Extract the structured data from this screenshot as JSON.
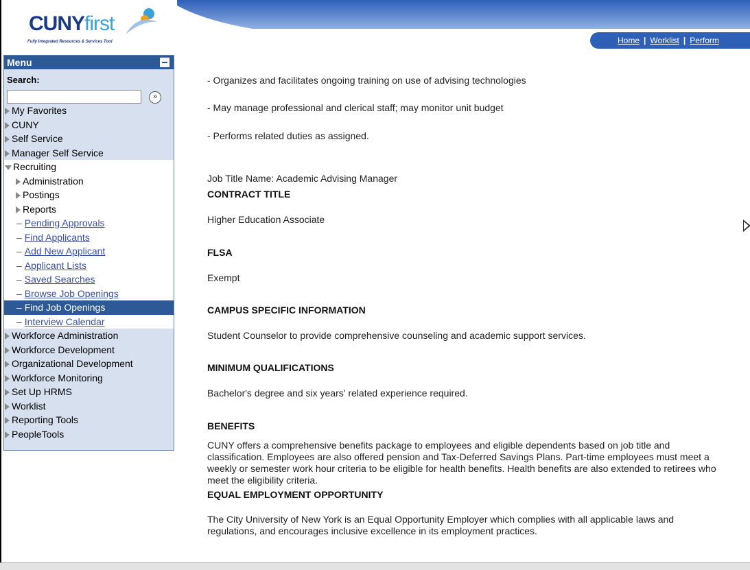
{
  "logo": {
    "brand_bold": "CUNY",
    "brand_thin": "first",
    "tagline": "Fully Integrated Resources & Services Tool"
  },
  "topnav": {
    "home": "Home",
    "worklist": "Worklist",
    "perform": "Perform"
  },
  "menu": {
    "title": "Menu",
    "search_label": "Search:",
    "search_value": "",
    "search_go": "»",
    "items": [
      {
        "label": "My Favorites"
      },
      {
        "label": "CUNY"
      },
      {
        "label": "Self Service"
      },
      {
        "label": "Manager Self Service"
      }
    ],
    "recruiting": {
      "label": "Recruiting",
      "folders": [
        {
          "label": "Administration"
        },
        {
          "label": "Postings"
        },
        {
          "label": "Reports"
        }
      ],
      "links": [
        {
          "label": "Pending Approvals"
        },
        {
          "label": "Find Applicants"
        },
        {
          "label": "Add New Applicant"
        },
        {
          "label": "Applicant Lists"
        },
        {
          "label": "Saved Searches"
        },
        {
          "label": "Browse Job Openings"
        },
        {
          "label": "Find Job Openings"
        },
        {
          "label": "Interview Calendar"
        }
      ]
    },
    "items_after": [
      {
        "label": "Workforce Administration"
      },
      {
        "label": "Workforce Development"
      },
      {
        "label": "Organizational Development"
      },
      {
        "label": "Workforce Monitoring"
      },
      {
        "label": "Set Up HRMS"
      },
      {
        "label": "Worklist"
      },
      {
        "label": "Reporting Tools"
      },
      {
        "label": "PeopleTools"
      }
    ]
  },
  "content": {
    "bullets": [
      "- Organizes and facilitates ongoing training on use of advising technologies",
      "- May manage professional and clerical staff; may monitor unit budget",
      "- Performs related duties as assigned."
    ],
    "job_title_name": "Job Title Name:  Academic Advising Manager",
    "sections": [
      {
        "heading": "CONTRACT TITLE",
        "text": "Higher Education Associate"
      },
      {
        "heading": "FLSA",
        "text": "Exempt"
      },
      {
        "heading": "CAMPUS SPECIFIC INFORMATION",
        "text": "Student Counselor to provide comprehensive counseling and academic support services."
      },
      {
        "heading": "MINIMUM QUALIFICATIONS",
        "text": "Bachelor's degree and six years' related experience required."
      },
      {
        "heading": "BENEFITS",
        "text": "CUNY offers a comprehensive benefits package to employees and eligible dependents based on job title and classification. Employees are also offered pension and Tax-Deferred Savings Plans.  Part-time employees must meet a weekly or semester work hour criteria to be eligible for health benefits. Health benefits are also extended to retirees who meet the eligibility criteria."
      },
      {
        "heading": "EQUAL EMPLOYMENT OPPORTUNITY",
        "text": "The City University of New York is an Equal Opportunity Employer which complies with all applicable laws and regulations, and encourages inclusive excellence in its employment practices."
      }
    ]
  }
}
